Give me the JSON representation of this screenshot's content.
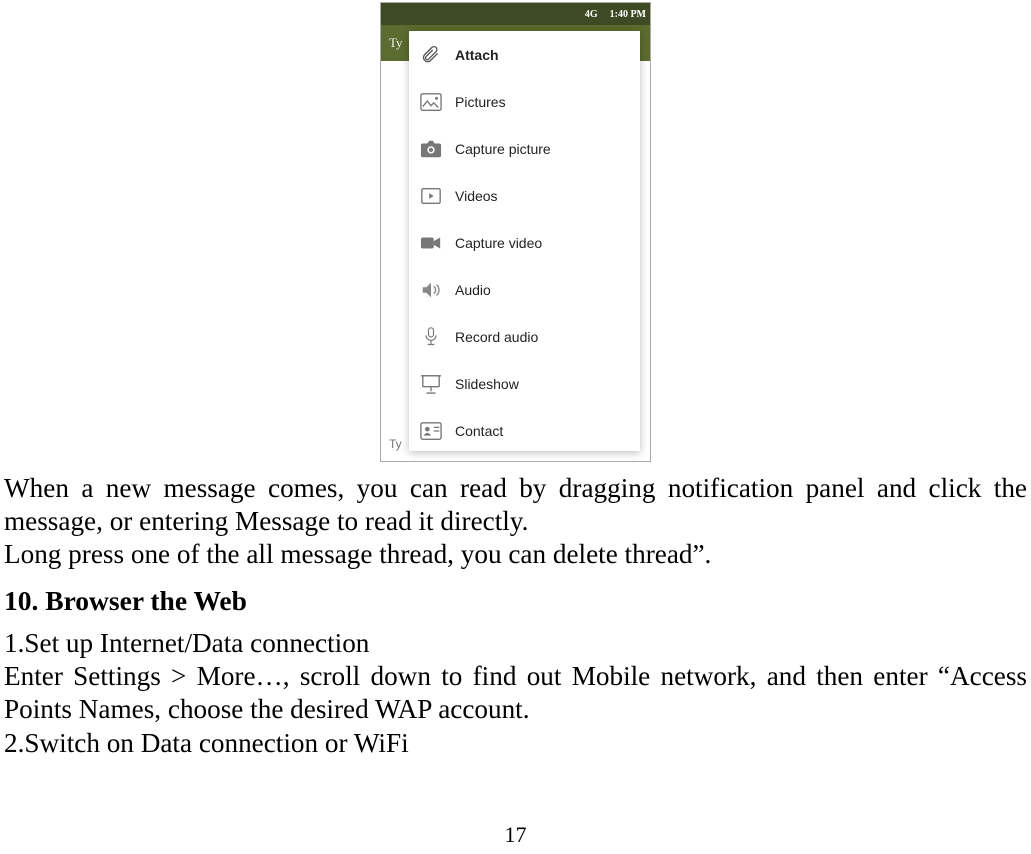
{
  "statusbar": {
    "network_label": "4G",
    "time": "1:40 PM"
  },
  "phone_header": {
    "placeholder": "Ty"
  },
  "menu": {
    "items": [
      {
        "label": "Attach"
      },
      {
        "label": "Pictures"
      },
      {
        "label": "Capture picture"
      },
      {
        "label": "Videos"
      },
      {
        "label": "Capture video"
      },
      {
        "label": "Audio"
      },
      {
        "label": "Record audio"
      },
      {
        "label": "Slideshow"
      },
      {
        "label": "Contact"
      }
    ]
  },
  "phone_footer": {
    "label": "Ty"
  },
  "doc": {
    "p1": "When a new message comes, you can read by dragging notification panel and click the message, or entering Message to read it directly.",
    "p2": "Long press one of the all message thread, you can delete thread”.",
    "heading": "10. Browser the Web",
    "p3": "1.Set up Internet/Data connection",
    "p4": "Enter Settings > More…, scroll down to find out Mobile network, and then enter “Access Points Names, choose the desired WAP account.",
    "p5": "2.Switch on Data connection or WiFi",
    "page_number": "17"
  }
}
